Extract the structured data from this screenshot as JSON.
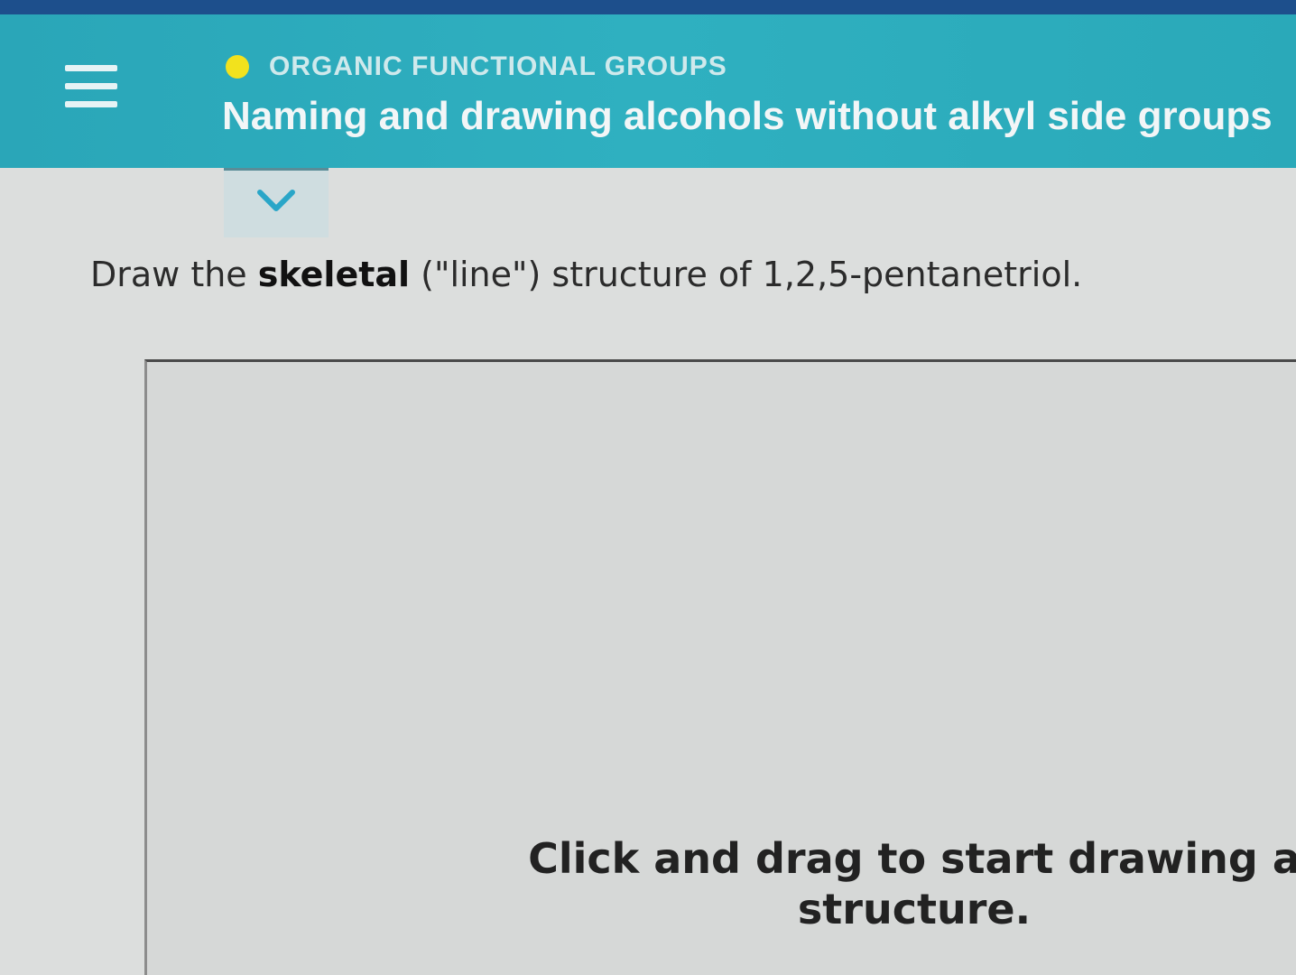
{
  "header": {
    "category": "ORGANIC FUNCTIONAL GROUPS",
    "title": "Naming and drawing alcohols without alkyl side groups",
    "status_color": "#f2e21d",
    "menu_icon": "hamburger-menu-icon"
  },
  "expand_tab": {
    "icon": "chevron-down-icon"
  },
  "question": {
    "prefix": "Draw the ",
    "bold": "skeletal",
    "suffix": " (\"line\") structure of 1,2,5-pentanetriol."
  },
  "canvas": {
    "hint_line1": "Click and drag to start drawing a",
    "hint_line2": "structure."
  }
}
